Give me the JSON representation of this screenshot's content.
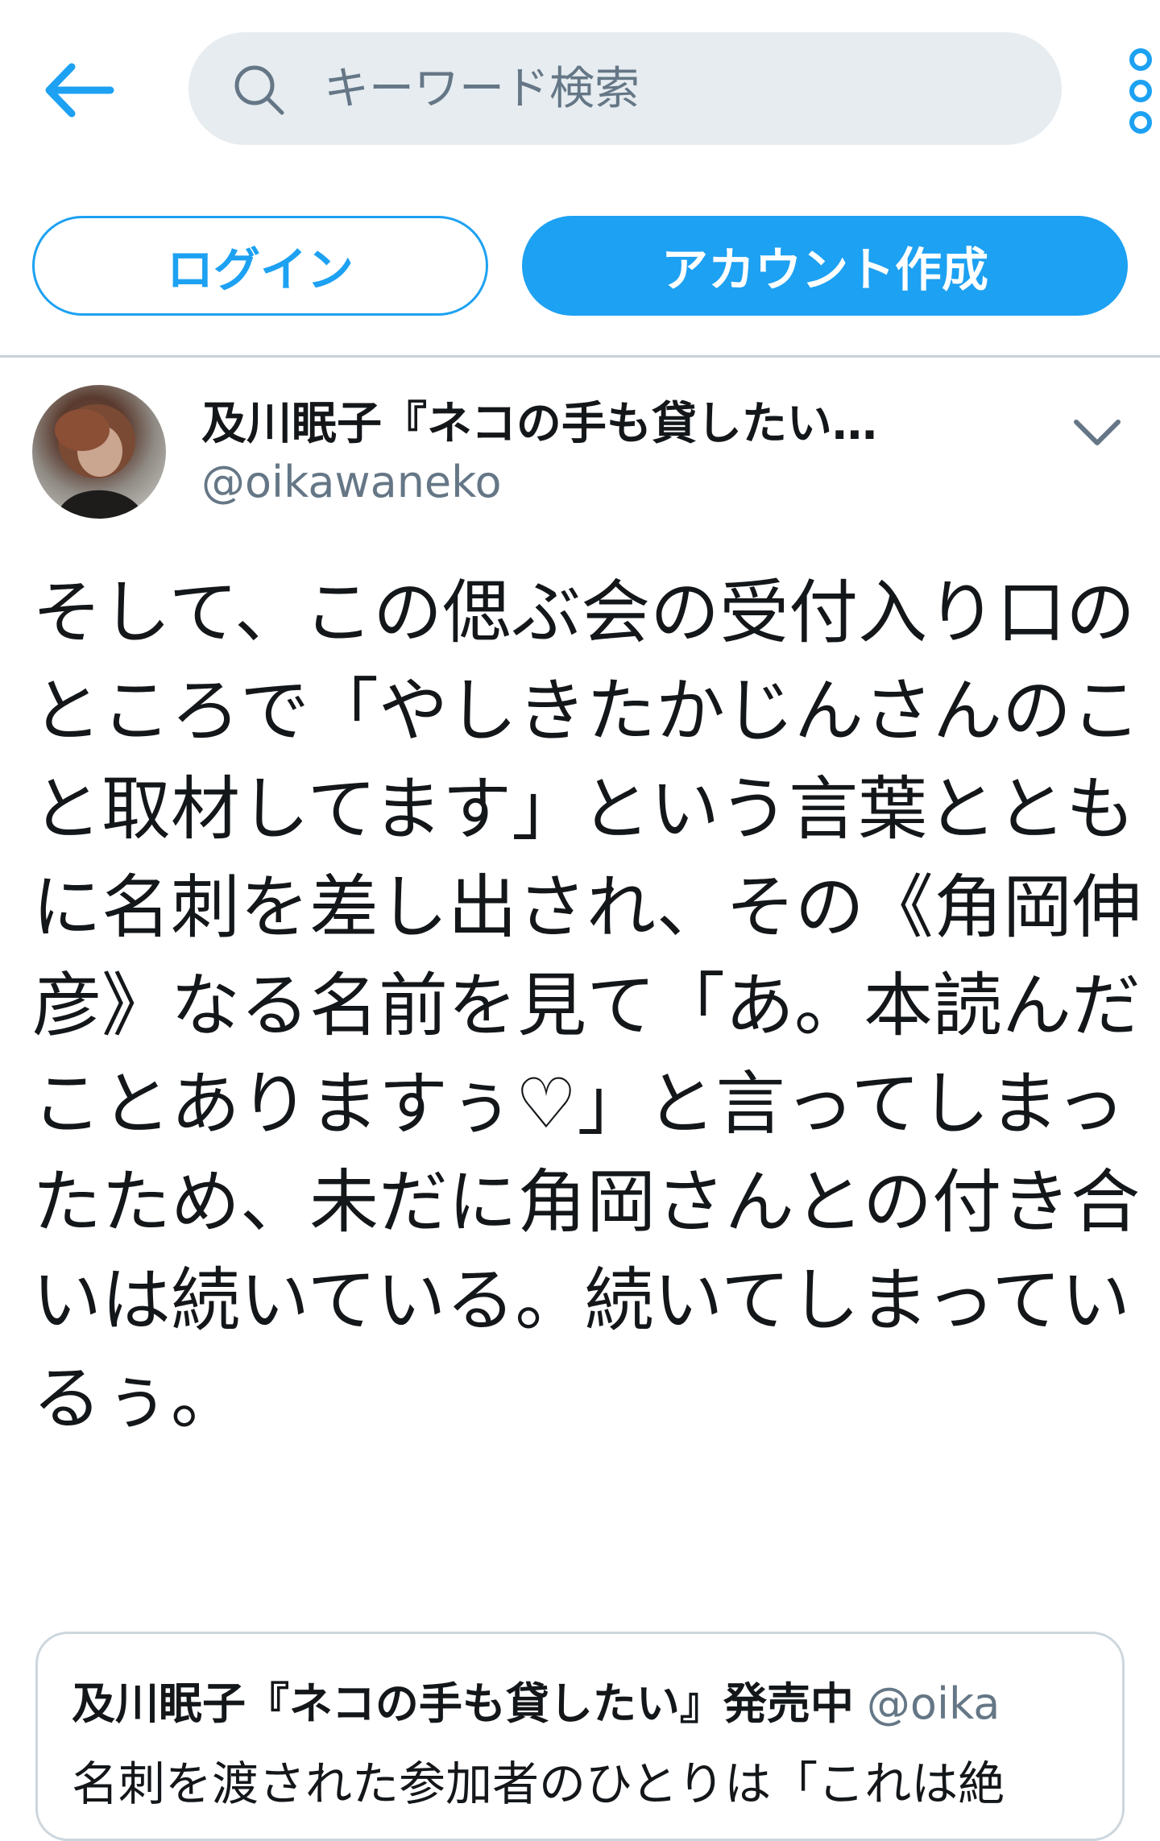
{
  "header": {
    "back_icon": "arrow-left-icon",
    "search": {
      "icon": "search-icon",
      "placeholder": "キーワード検索",
      "value": ""
    },
    "more_icon": "vertical-dots-icon"
  },
  "auth": {
    "login_label": "ログイン",
    "signup_label": "アカウント作成"
  },
  "tweet": {
    "display_name": "及川眠子『ネコの手も貸したい…",
    "handle": "@oikawaneko",
    "caret_icon": "chevron-down-icon",
    "text": "そして、この偲ぶ会の受付入り口のところで「やしきたかじんさんのこと取材してます」という言葉とともに名刺を差し出され、その《角岡伸彦》なる名前を見て「あ。本読んだことありますぅ♡」と言ってしまったため、未だに角岡さんとの付き合いは続いている。続いてしまっているぅ。"
  },
  "quote": {
    "display_name": "及川眠子『ネコの手も貸したい』発売中",
    "handle": "@oika",
    "text": "名刺を渡された参加者のひとりは「これは絶"
  },
  "colors": {
    "accent": "#1da1f2",
    "text": "#14171a",
    "muted": "#657786",
    "search_bg": "#e6ecf0",
    "border": "#ccd6dd"
  }
}
